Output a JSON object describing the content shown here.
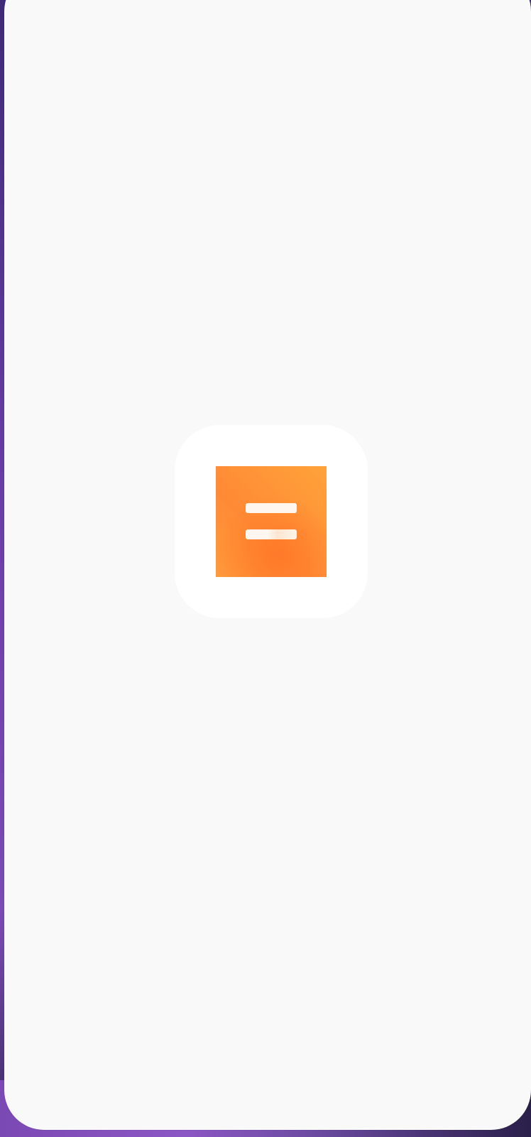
{
  "screen": {
    "type": "splash",
    "background_color": "#f9f9f9",
    "wallpaper_colors": [
      "#3d2a78",
      "#7a4bb3",
      "#2a1f4a"
    ]
  },
  "app_icon": {
    "icon_name": "app-logo-icon",
    "tile_color": "#ffffff",
    "logo_colors": [
      "#ff8a35",
      "#ffa33a"
    ],
    "bar_color": "#fff7ef"
  }
}
